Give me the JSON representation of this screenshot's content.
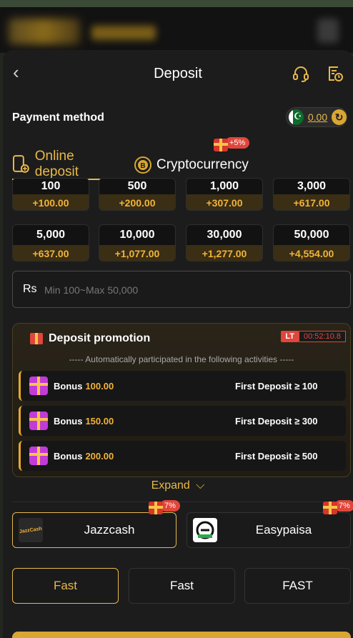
{
  "header": {
    "title": "Deposit",
    "back_icon": "chevron-left-icon",
    "support_icon": "headset-icon",
    "history_icon": "history-icon"
  },
  "payment": {
    "label": "Payment method",
    "balance": "0.00",
    "flag_icon": "pakistan-flag-icon",
    "refresh_icon": "refresh-icon"
  },
  "tabs": [
    {
      "label": "Online deposit",
      "icon": "phone-deposit-icon",
      "active": true
    },
    {
      "label": "Cryptocurrency",
      "icon": "bitcoin-icon",
      "active": false,
      "badge": "+5%"
    }
  ],
  "amounts": [
    {
      "value": "100",
      "bonus": "+100.00"
    },
    {
      "value": "500",
      "bonus": "+200.00"
    },
    {
      "value": "1,000",
      "bonus": "+307.00"
    },
    {
      "value": "3,000",
      "bonus": "+617.00"
    },
    {
      "value": "5,000",
      "bonus": "+637.00"
    },
    {
      "value": "10,000",
      "bonus": "+1,077.00"
    },
    {
      "value": "30,000",
      "bonus": "+1,277.00"
    },
    {
      "value": "50,000",
      "bonus": "+4,554.00"
    }
  ],
  "input": {
    "currency": "Rs",
    "placeholder": "Min 100~Max 50,000",
    "value": ""
  },
  "promotion": {
    "title": "Deposit promotion",
    "lt_label": "LT",
    "timer": "00:52:10.8",
    "subtitle": "----- Automatically participated in the following activities -----",
    "rows": [
      {
        "label": "Bonus",
        "amount": "100.00",
        "condition": "First Deposit ≥ 100"
      },
      {
        "label": "Bonus",
        "amount": "150.00",
        "condition": "First Deposit ≥ 300"
      },
      {
        "label": "Bonus",
        "amount": "200.00",
        "condition": "First Deposit ≥ 500"
      }
    ],
    "expand_label": "Expand",
    "expand_icon": "chevron-down-icon"
  },
  "channels": [
    {
      "name": "Jazzcash",
      "badge": "7%",
      "selected": true,
      "logo_text": "JazzCash"
    },
    {
      "name": "Easypaisa",
      "badge": "7%",
      "selected": false
    }
  ],
  "speeds": [
    {
      "label": "Fast",
      "selected": true
    },
    {
      "label": "Fast",
      "selected": false
    },
    {
      "label": "FAST",
      "selected": false
    }
  ],
  "colors": {
    "accent": "#e8b84a",
    "bonus": "#f2b33a",
    "badge": "#e0463b",
    "background": "#1c1c1c"
  }
}
